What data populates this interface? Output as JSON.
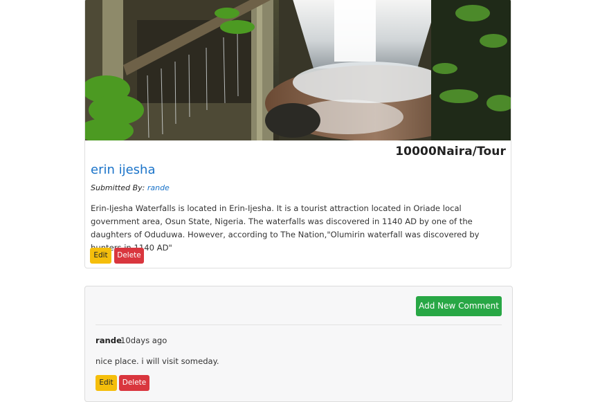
{
  "campground": {
    "price": "10000Naira/Tour",
    "title": "erin ijesha",
    "submitted_prefix": "Submitted By:",
    "author": "rande",
    "description": "Erin-Ijesha Waterfalls is located in Erin-Ijesha. It is a tourist attraction located in Oriade local government area, Osun State, Nigeria. The waterfalls was discovered in 1140 AD by one of the daughters of Oduduwa. However, according to The Nation,\"Olumirin waterfall was discovered by hunters in 1140 AD\"",
    "edit_label": "Edit",
    "delete_label": "Delete"
  },
  "comments": {
    "add_label": "Add New Comment",
    "items": [
      {
        "author": "rande",
        "time": "10days ago",
        "text": "nice place. i will visit someday.",
        "edit_label": "Edit",
        "delete_label": "Delete"
      }
    ]
  },
  "colors": {
    "link": "#1a73c9",
    "edit": "#f5be0b",
    "delete": "#d9363e",
    "add": "#28a745"
  }
}
